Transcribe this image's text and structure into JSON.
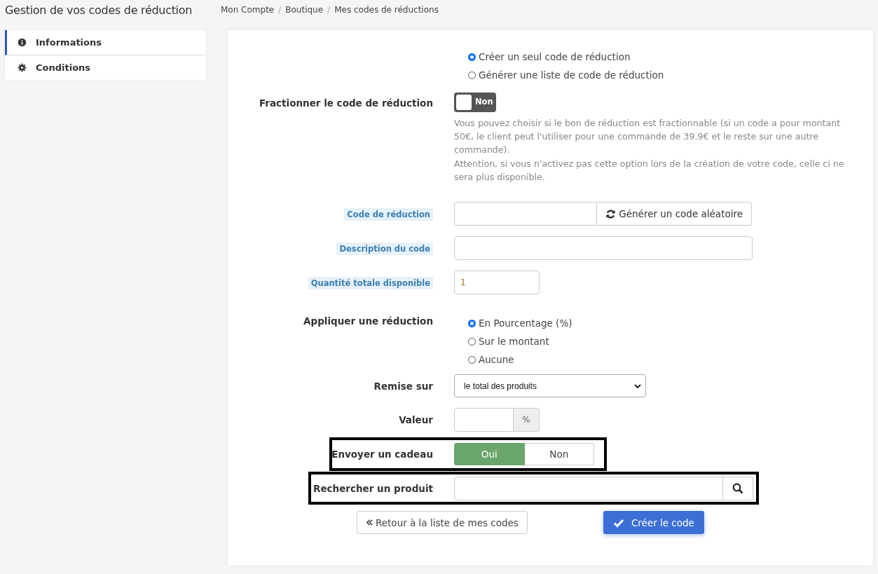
{
  "page_title": "Gestion de vos codes de réduction",
  "breadcrumb": {
    "separator": "/",
    "items": [
      {
        "label": "Mon Compte"
      },
      {
        "label": "Boutique"
      },
      {
        "label": "Mes codes de réductions"
      }
    ]
  },
  "sidebar": {
    "items": [
      {
        "label": "Informations",
        "selected": true
      },
      {
        "label": "Conditions",
        "selected": false
      }
    ]
  },
  "form": {
    "mode_options": [
      {
        "label": "Créer un seul code de réduction",
        "selected": true
      },
      {
        "label": "Générer une liste de code de réduction",
        "selected": false
      }
    ],
    "split": {
      "label": "Fractionner le code de réduction",
      "on": false,
      "state_text": "Non",
      "help": [
        "Vous pouvez choisir si le bon de réduction est fractionnable (si un code a pour montant 50€, le client peut l'utiliser pour une commande de 39.9€ et le reste sur une autre commande).",
        "Attention, si vous n'activez pas cette option lors de la création de votre code, celle ci ne sera plus disponible."
      ]
    },
    "code": {
      "label": "Code de réduction",
      "button": "Générer un code aléatoire"
    },
    "description": {
      "label": "Description du code"
    },
    "quantity": {
      "label": "Quantité totale disponible",
      "value": "1"
    },
    "discount": {
      "label": "Appliquer une réduction",
      "options": [
        {
          "label": "En Pourcentage (%)",
          "selected": true
        },
        {
          "label": "Sur le montant",
          "selected": false
        },
        {
          "label": "Aucune",
          "selected": false
        }
      ]
    },
    "apply_to": {
      "label": "Remise sur",
      "value": "le total des produits"
    },
    "amount": {
      "label": "Valeur",
      "unit": "%"
    },
    "gift": {
      "label": "Envoyer un cadeau",
      "highlighted": true,
      "options": [
        {
          "label": "Oui",
          "selected": true
        },
        {
          "label": "Non",
          "selected": false
        }
      ]
    },
    "product_search": {
      "label": "Rechercher un produit",
      "highlighted": true
    }
  },
  "buttons": {
    "back": "Retour à la liste de mes codes",
    "submit": "Créer le code"
  }
}
